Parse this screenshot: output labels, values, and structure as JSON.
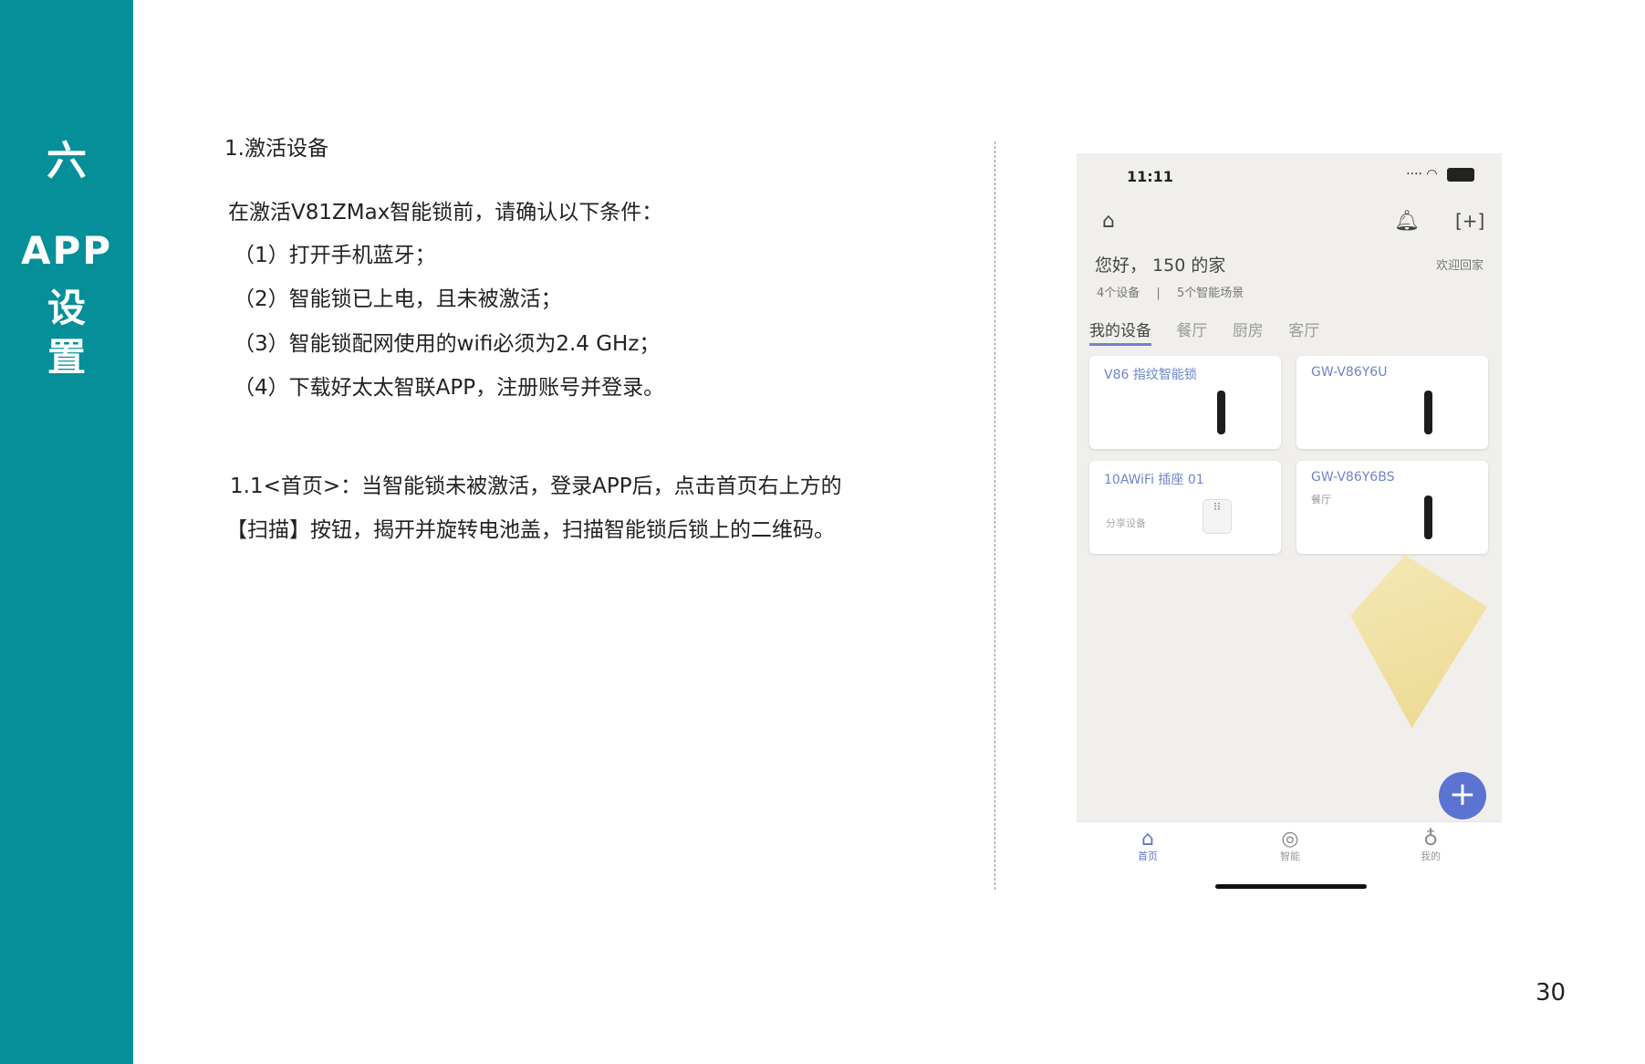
{
  "sidebar": {
    "chapter_number": "六",
    "title_line1": "APP",
    "title_line2": "设",
    "title_line3": "置"
  },
  "content": {
    "section_title": "1.激活设备",
    "intro": "在激活V81ZMax智能锁前，请确认以下条件：",
    "conditions": [
      "（1）打开手机蓝牙；",
      "（2）智能锁已上电，且未被激活；",
      "（3）智能锁配网使用的wifi必须为2.4 GHz；",
      "（4）下载好太太智联APP，注册账号并登录。"
    ],
    "step_line1": "1.1<首页>：当智能锁未被激活，登录APP后，点击首页右上方的",
    "step_line2": "【扫描】按钮，揭开并旋转电池盖，扫描智能锁后锁上的二维码。"
  },
  "page_number": "30",
  "colors": {
    "sidebar": "#058f99",
    "accent": "#5b74d1"
  },
  "phone": {
    "time": "11:11",
    "greeting": "您好， 150 的家",
    "welcome": "欢迎回家",
    "device_count": "4个设备",
    "scene_count": "5个智能场景",
    "tabs": [
      "我的设备",
      "餐厅",
      "厨房",
      "客厅"
    ],
    "cards": [
      {
        "name": "V86 指纹智能锁",
        "sub": ""
      },
      {
        "name": "GW-V86Y6U",
        "sub": ""
      },
      {
        "name": "10AWiFi 插座 01",
        "sub": "分享设备"
      },
      {
        "name": "GW-V86Y6BS",
        "sub": "餐厅"
      }
    ],
    "nav": {
      "home": "首页",
      "smart": "智能",
      "me": "我的"
    },
    "icons": [
      "home-icon",
      "bell-icon",
      "scan-icon",
      "plus-icon",
      "chat-icon",
      "user-icon"
    ]
  }
}
